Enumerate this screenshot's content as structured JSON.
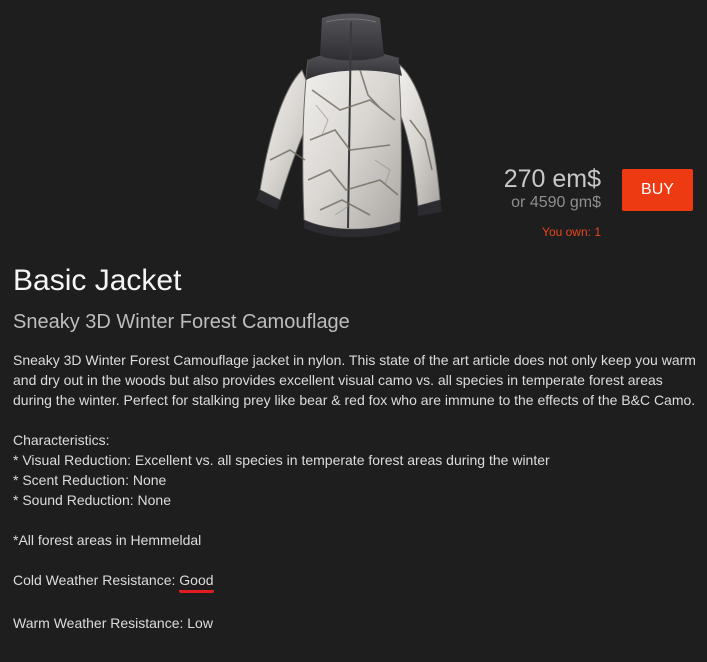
{
  "product": {
    "price_em": "270 em$",
    "price_gm": "or 4590 gm$",
    "buy_label": "BUY",
    "owned_text": "You own: 1",
    "title": "Basic Jacket",
    "subtitle": "Sneaky 3D Winter Forest Camouflage",
    "description": "Sneaky 3D Winter Forest Camouflage jacket in nylon. This state of the art article does not only keep you warm and dry out in the woods but also provides excellent visual camo vs. all species in temperate forest areas during the winter. Perfect for stalking prey like bear & red fox who are immune to the effects of the B&C Camo.",
    "characteristics_heading": "Characteristics:",
    "characteristics": [
      "* Visual Reduction: Excellent vs. all species in temperate forest areas during the winter",
      "* Scent Reduction: None",
      "* Sound Reduction: None"
    ],
    "footnote": "*All forest areas in Hemmeldal",
    "cold_label": "Cold Weather Resistance: ",
    "cold_value": "Good",
    "warm_text": "Warm Weather Resistance: Low"
  },
  "colors": {
    "background": "#1e1e1f",
    "buy_button": "#ee3a12",
    "owned_text": "#e8451e",
    "underline": "#e11b22"
  },
  "icons": {
    "product_image": "winter-camo-jacket"
  }
}
